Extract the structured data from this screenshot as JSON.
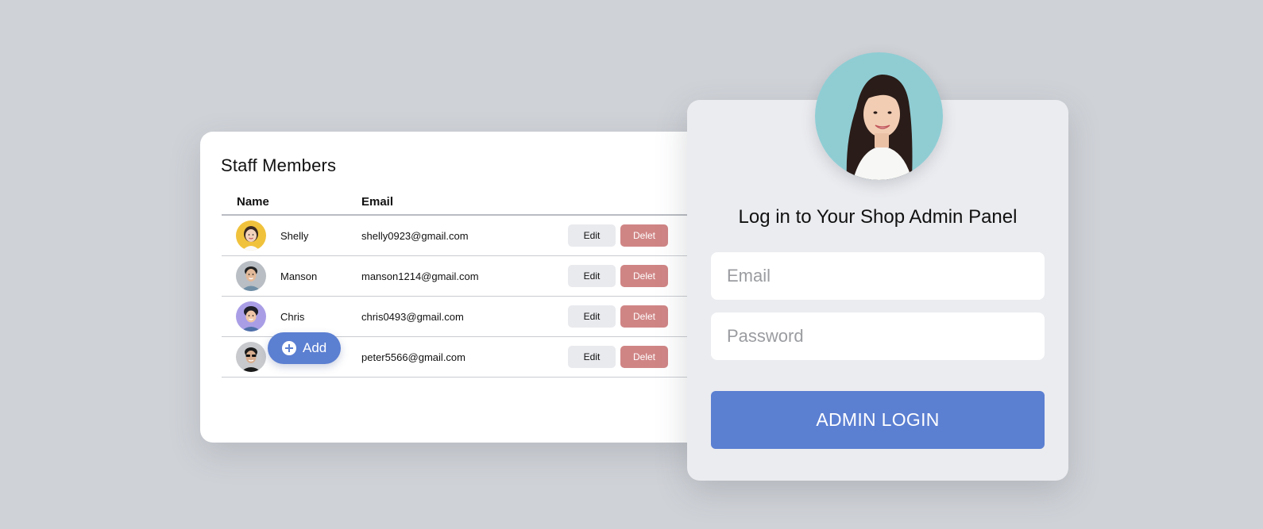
{
  "staff": {
    "title": "Staff Members",
    "columns": {
      "name": "Name",
      "email": "Email"
    },
    "rows": [
      {
        "name": "Shelly",
        "email": "shelly0923@gmail.com",
        "avatar_color": "#f0c23c"
      },
      {
        "name": "Manson",
        "email": "manson1214@gmail.com",
        "avatar_color": "#b9bec4"
      },
      {
        "name": "Chris",
        "email": "chris0493@gmail.com",
        "avatar_color": "#a99ee6"
      },
      {
        "name": "",
        "email": "peter5566@gmail.com",
        "avatar_color": "#c7c9cc"
      }
    ],
    "edit_label": "Edit",
    "delete_label": "Delet",
    "add_label": "Add"
  },
  "login": {
    "title": "Log in to Your Shop Admin Panel",
    "email_placeholder": "Email",
    "password_placeholder": "Password",
    "button_label": "ADMIN LOGIN"
  },
  "colors": {
    "background": "#cfd2d7",
    "accent": "#5b7fd1",
    "delete": "#d08585",
    "edit": "#e9eaee",
    "login_card": "#ebecf0"
  }
}
